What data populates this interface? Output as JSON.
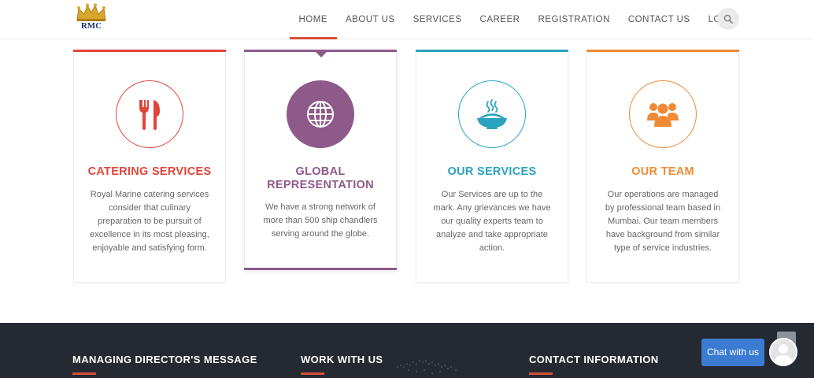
{
  "header": {
    "logo_text": "RMC",
    "nav": [
      "HOME",
      "ABOUT US",
      "SERVICES",
      "CAREER",
      "REGISTRATION",
      "CONTACT US",
      "LOGIN"
    ],
    "active_nav": "HOME"
  },
  "cards": [
    {
      "title": "CATERING SERVICES",
      "text": [
        "Royal Marine catering services",
        "consider that culinary",
        "preparation to be pursuit of",
        "excellence in its most pleasing,",
        "enjoyable and satisfying form."
      ],
      "color": "#e0453a",
      "icon": "cutlery-icon"
    },
    {
      "title": "GLOBAL REPRESENTATION",
      "text": [
        "We have a strong network of",
        "more than 500 ship chandlers",
        "serving around the globe."
      ],
      "color": "#8e5a8a",
      "icon": "globe-icon"
    },
    {
      "title": "OUR SERVICES",
      "text": [
        "Our Services are up to the",
        "mark. Any grievances we have",
        "our quality experts team to",
        "analyze and take appropriate",
        "action."
      ],
      "color": "#2ba3bf",
      "icon": "food-bowl-icon"
    },
    {
      "title": "OUR TEAM",
      "text": [
        "Our operations are managed",
        "by professional team based in",
        "Mumbai. Our team members",
        "have background from similar",
        "type of service industries."
      ],
      "color": "#f08a35",
      "icon": "team-icon"
    }
  ],
  "footer": {
    "headings": [
      "MANAGING DIRECTOR'S MESSAGE",
      "WORK WITH US",
      "CONTACT INFORMATION"
    ],
    "accent": "#d84f3a"
  },
  "chat": {
    "label": "Chat with us"
  }
}
